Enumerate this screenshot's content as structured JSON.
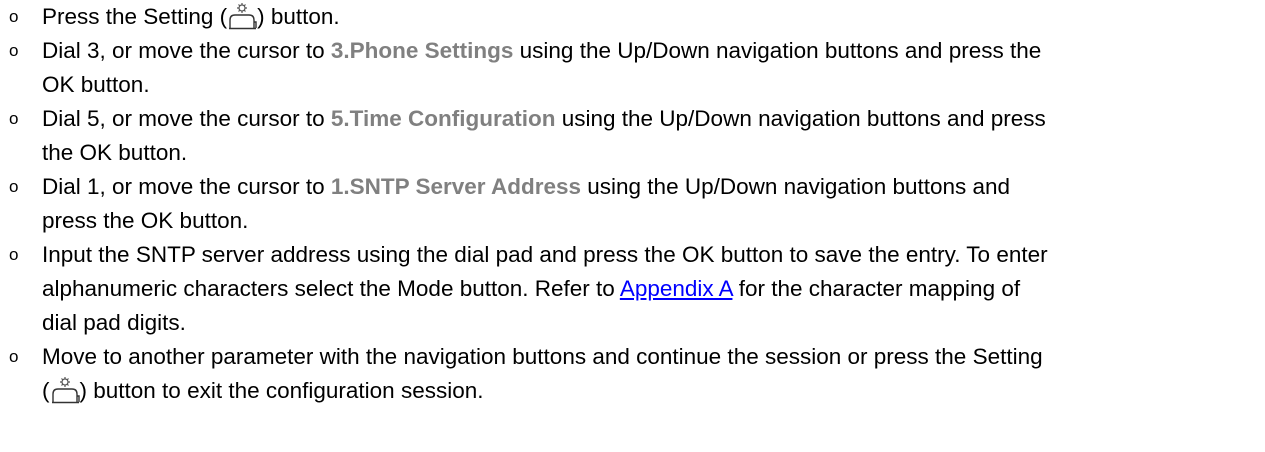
{
  "bullet": "o",
  "steps": [
    {
      "a": "Press the Setting (",
      "icon": "setting-button-icon",
      "b": ") button."
    },
    {
      "a": "Dial 3, or move the cursor to ",
      "hl": "3.Phone Settings",
      "b": " using the Up/Down navigation buttons and press the",
      "c": "OK button."
    },
    {
      "a": "Dial 5, or move the cursor to ",
      "hl": "5.Time Configuration",
      "b": " using the Up/Down navigation buttons and press",
      "c": "the OK button."
    },
    {
      "a": "Dial 1, or move the cursor to ",
      "hl": "1.SNTP Server Address",
      "b": " using the Up/Down navigation buttons and",
      "c": "press the OK button."
    },
    {
      "a": "Input the SNTP server address using the dial pad and press the OK button to save the entry.  To enter",
      "b": "alphanumeric characters select the Mode button.  Refer to ",
      "link": "Appendix A",
      "c": " for the character mapping of",
      "d": "dial pad digits."
    },
    {
      "a": "Move to another parameter with the navigation buttons and continue the session or press the Setting",
      "b": "(",
      "icon": "setting-button-icon",
      "c": ") button to exit the configuration session."
    }
  ]
}
